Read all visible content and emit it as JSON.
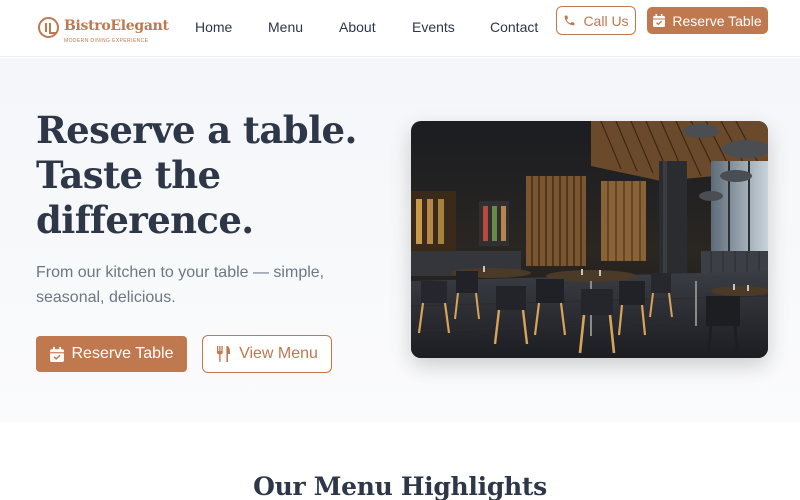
{
  "brand": {
    "name": "BistroElegant",
    "tagline": "MODERN DINING EXPERIENCE",
    "accent_color": "#c0784f"
  },
  "nav": {
    "items": [
      {
        "label": "Home"
      },
      {
        "label": "Menu"
      },
      {
        "label": "About"
      },
      {
        "label": "Events"
      },
      {
        "label": "Contact"
      }
    ]
  },
  "header_actions": {
    "call_label": "Call Us",
    "call_icon": "phone-icon",
    "reserve_label": "Reserve Table",
    "reserve_icon": "calendar-icon"
  },
  "hero": {
    "title_lines": [
      "Reserve a table.",
      "Taste the",
      "difference."
    ],
    "subtitle": "From our kitchen to your table — simple, seasonal, delicious.",
    "primary_button": {
      "label": "Reserve Table",
      "icon": "calendar-icon"
    },
    "secondary_button": {
      "label": "View Menu",
      "icon": "utensils-icon"
    },
    "image": "restaurant-interior-photo"
  },
  "menu_section": {
    "title": "Our Menu Highlights"
  }
}
